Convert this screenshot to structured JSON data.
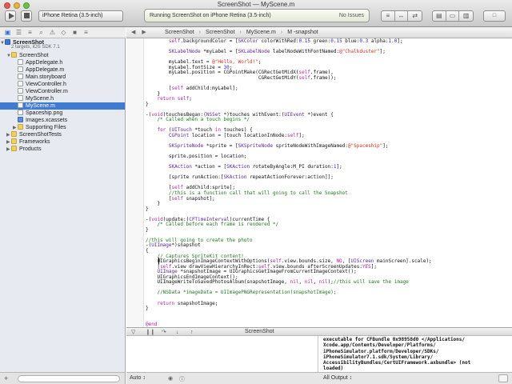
{
  "window": {
    "title": "ScreenShot — MyScene.m",
    "scheme": "iPhone Retina (3.5-inch)",
    "activity": "Running ScreenShot on iPhone Retina (3.5-inch)",
    "issues": "No Issues",
    "organizer": "□"
  },
  "toolbar": {
    "editor_icons": [
      "≡",
      "↔",
      "⇄"
    ],
    "view_icons": [
      "▤",
      "▭",
      "▥"
    ]
  },
  "jumpbar": {
    "arrows": "◀ ▶",
    "crumbs": [
      "ScreenShot",
      "ScreenShot",
      "MyScene.m",
      "M -snapshot"
    ]
  },
  "navigator": {
    "tabs": [
      "▣",
      "☰",
      "≡",
      "⌕",
      "⚠",
      "◇",
      "■",
      "≡"
    ],
    "project": "ScreenShot",
    "project_sub": "2 targets, iOS SDK 7.1",
    "items": [
      {
        "label": "ScreenShot",
        "icon": "folder",
        "indent": 1
      },
      {
        "label": "AppDelegate.h",
        "icon": "h",
        "indent": 2
      },
      {
        "label": "AppDelegate.m",
        "icon": "m",
        "indent": 2
      },
      {
        "label": "Main.storyboard",
        "icon": "file",
        "indent": 2
      },
      {
        "label": "ViewController.h",
        "icon": "h",
        "indent": 2
      },
      {
        "label": "ViewController.m",
        "icon": "m",
        "indent": 2
      },
      {
        "label": "MyScene.h",
        "icon": "h",
        "indent": 2
      },
      {
        "label": "MyScene.m",
        "icon": "m",
        "indent": 2,
        "selected": true
      },
      {
        "label": "Spaceship.png",
        "icon": "file",
        "indent": 2
      },
      {
        "label": "Images.xcassets",
        "icon": "xc",
        "indent": 2
      },
      {
        "label": "Supporting Files",
        "icon": "folder",
        "indent": 2
      },
      {
        "label": "ScreenShotTests",
        "icon": "folder",
        "indent": 1
      },
      {
        "label": "Frameworks",
        "icon": "folder",
        "indent": 1
      },
      {
        "label": "Products",
        "icon": "folder",
        "indent": 1
      }
    ]
  },
  "code": {
    "lines": [
      {
        "n": "",
        "t": "        self.backgroundColor = [SKColor colorWithRed:0.15 green:0.15 blue:0.3 alpha:1.0];"
      },
      {
        "n": "",
        "t": ""
      },
      {
        "n": "",
        "t": "        SKLabelNode *myLabel = [SKLabelNode labelNodeWithFontNamed:@\"Chalkduster\"];"
      },
      {
        "n": "",
        "t": ""
      },
      {
        "n": "",
        "t": "        myLabel.text = @\"Hello, World!\";"
      },
      {
        "n": "",
        "t": "        myLabel.fontSize = 30;"
      },
      {
        "n": "",
        "t": "        myLabel.position = CGPointMake(CGRectGetMidX(self.frame),"
      },
      {
        "n": "",
        "t": "                                       CGRectGetMidY(self.frame));"
      },
      {
        "n": "",
        "t": ""
      },
      {
        "n": "",
        "t": "        [self addChild:myLabel];"
      },
      {
        "n": "",
        "t": "    }"
      },
      {
        "n": "",
        "t": "    return self;"
      },
      {
        "n": "",
        "t": "}"
      },
      {
        "n": "",
        "t": ""
      },
      {
        "n": "",
        "t": "-(void)touchesBegan:(NSSet *)touches withEvent:(UIEvent *)event {"
      },
      {
        "n": "",
        "t": "    /* Called when a touch begins */"
      },
      {
        "n": "",
        "t": ""
      },
      {
        "n": "",
        "t": "    for (UITouch *touch in touches) {"
      },
      {
        "n": "",
        "t": "        CGPoint location = [touch locationInNode:self];"
      },
      {
        "n": "",
        "t": ""
      },
      {
        "n": "",
        "t": "        SKSpriteNode *sprite = [SKSpriteNode spriteNodeWithImageNamed:@\"Spaceship\"];"
      },
      {
        "n": "",
        "t": ""
      },
      {
        "n": "",
        "t": "        sprite.position = location;"
      },
      {
        "n": "",
        "t": ""
      },
      {
        "n": "",
        "t": "        SKAction *action = [SKAction rotateByAngle:M_PI duration:1];"
      },
      {
        "n": "",
        "t": ""
      },
      {
        "n": "",
        "t": "        [sprite runAction:[SKAction repeatActionForever:action]];"
      },
      {
        "n": "",
        "t": ""
      },
      {
        "n": "",
        "t": "        [self addChild:sprite];"
      },
      {
        "n": "",
        "t": "        //this is a function call that will going to call the Snapshot"
      },
      {
        "n": "",
        "t": "        [self snapshot];"
      },
      {
        "n": "",
        "t": "    }"
      },
      {
        "n": "",
        "t": "}"
      },
      {
        "n": "",
        "t": ""
      },
      {
        "n": "",
        "t": "-(void)update:(CFTimeInterval)currentTime {"
      },
      {
        "n": "",
        "t": "    /* Called before each frame is rendered */"
      },
      {
        "n": "",
        "t": "}"
      },
      {
        "n": "",
        "t": ""
      },
      {
        "n": "",
        "t": "//this will going to create the photo"
      },
      {
        "n": "",
        "t": "-(UIImage*)snapshot"
      },
      {
        "n": "",
        "t": "{"
      },
      {
        "n": "",
        "t": "    // Captures SpriteKit content!"
      },
      {
        "n": "",
        "t": "    UIGraphicsBeginImageContextWithOptions(self.view.bounds.size, NO, [UIScreen mainScreen].scale);"
      },
      {
        "n": "",
        "t": "    [self.view drawViewHierarchyInRect:self.view.bounds afterScreenUpdates:YES];"
      },
      {
        "n": "",
        "t": "    UIImage *snapshotImage = UIGraphicsGetImageFromCurrentImageContext();"
      },
      {
        "n": "",
        "t": "    UIGraphicsEndImageContext();"
      },
      {
        "n": "",
        "t": "    UIImageWriteToSavedPhotosAlbum(snapshotImage, nil, nil, nil);//this will save the image"
      },
      {
        "n": "",
        "t": ""
      },
      {
        "n": "",
        "t": "    //NSData *imageData = UIImagePNGRepresentation(snapshotImage);"
      },
      {
        "n": "",
        "t": ""
      },
      {
        "n": "",
        "t": "    return snapshotImage;"
      },
      {
        "n": "",
        "t": "}"
      },
      {
        "n": "",
        "t": ""
      },
      {
        "n": "",
        "t": ""
      },
      {
        "n": "",
        "t": "@end"
      }
    ]
  },
  "debug": {
    "target": "ScreenShot",
    "icons": [
      "▽",
      "❙❙",
      "↷",
      "↓",
      "↑"
    ],
    "auto": "Auto ↕",
    "all_output": "All Output ↕",
    "console": "executable for CFBundle 0x98958d0 </Applications/\nXcode.app/Contents/Developer/Platforms/\niPhoneSimulator.platform/Developer/SDKs/\niPhoneSimulator7.1.sdk/System/Library/\nAccessibilityBundles/CertUIFramework.axbundle> (not\nloaded)"
  },
  "colors": {
    "selection": "#3f7ad3",
    "keyword": "#b0259a",
    "string": "#d12f1b",
    "comment": "#1e7a1e"
  }
}
